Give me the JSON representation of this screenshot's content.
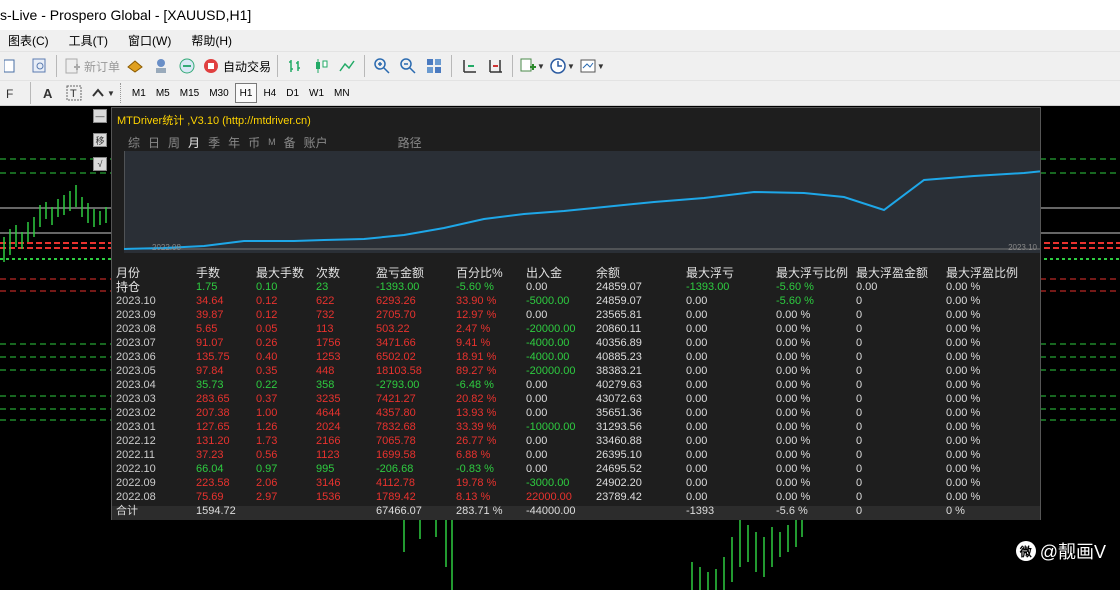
{
  "window": {
    "title": "s-Live - Prospero Global - [XAUUSD,H1]"
  },
  "menu": [
    "图表(C)",
    "工具(T)",
    "窗口(W)",
    "帮助(H)"
  ],
  "toolbar": {
    "new_order": "新订单",
    "auto_trade": "自动交易"
  },
  "timeframes": [
    "M1",
    "M5",
    "M15",
    "M30",
    "H1",
    "H4",
    "D1",
    "W1",
    "MN"
  ],
  "active_timeframe": "H1",
  "panel": {
    "title": "MTDriver统计 ,V3.10 (http://mtdriver.cn)",
    "tabs": [
      "综",
      "日",
      "周",
      "月",
      "季",
      "年",
      "币",
      "M",
      "备",
      "账户",
      "路径"
    ],
    "active_tab": "月",
    "curve_start_label": "2022.08",
    "curve_end_label": "2023.10"
  },
  "table": {
    "headers": [
      "月份",
      "手数",
      "最大手数",
      "次数",
      "盈亏金额",
      "百分比%",
      "出入金",
      "余额",
      "最大浮亏",
      "最大浮亏比例",
      "最大浮盈金额",
      "最大浮盈比例"
    ],
    "hold": {
      "label": "持仓",
      "lots": "1.75",
      "maxlot": "0.10",
      "count": "23",
      "pl": "-1393.00",
      "pct": "-5.60 %",
      "io": "0.00",
      "bal": "24859.07",
      "mdd": "-1393.00",
      "mddp": "-5.60 %",
      "mfp": "0.00",
      "mfpp": "0.00 %"
    },
    "rows": [
      {
        "month": "2023.10",
        "lots": "34.64",
        "maxlot": "0.12",
        "count": "622",
        "pl": "6293.26",
        "pct": "33.90 %",
        "io": "-5000.00",
        "bal": "24859.07",
        "mdd": "0.00",
        "mddp": "-5.60 %",
        "mfp": "0",
        "mfpp": "0.00 %",
        "pos": true
      },
      {
        "month": "2023.09",
        "lots": "39.87",
        "maxlot": "0.12",
        "count": "732",
        "pl": "2705.70",
        "pct": "12.97 %",
        "io": "0.00",
        "bal": "23565.81",
        "mdd": "0.00",
        "mddp": "0.00 %",
        "mfp": "0",
        "mfpp": "0.00 %",
        "pos": true
      },
      {
        "month": "2023.08",
        "lots": "5.65",
        "maxlot": "0.05",
        "count": "113",
        "pl": "503.22",
        "pct": "2.47 %",
        "io": "-20000.00",
        "bal": "20860.11",
        "mdd": "0.00",
        "mddp": "0.00 %",
        "mfp": "0",
        "mfpp": "0.00 %",
        "pos": true
      },
      {
        "month": "2023.07",
        "lots": "91.07",
        "maxlot": "0.26",
        "count": "1756",
        "pl": "3471.66",
        "pct": "9.41 %",
        "io": "-4000.00",
        "bal": "40356.89",
        "mdd": "0.00",
        "mddp": "0.00 %",
        "mfp": "0",
        "mfpp": "0.00 %",
        "pos": true
      },
      {
        "month": "2023.06",
        "lots": "135.75",
        "maxlot": "0.40",
        "count": "1253",
        "pl": "6502.02",
        "pct": "18.91 %",
        "io": "-4000.00",
        "bal": "40885.23",
        "mdd": "0.00",
        "mddp": "0.00 %",
        "mfp": "0",
        "mfpp": "0.00 %",
        "pos": true
      },
      {
        "month": "2023.05",
        "lots": "97.84",
        "maxlot": "0.35",
        "count": "448",
        "pl": "18103.58",
        "pct": "89.27 %",
        "io": "-20000.00",
        "bal": "38383.21",
        "mdd": "0.00",
        "mddp": "0.00 %",
        "mfp": "0",
        "mfpp": "0.00 %",
        "pos": true
      },
      {
        "month": "2023.04",
        "lots": "35.73",
        "maxlot": "0.22",
        "count": "358",
        "pl": "-2793.00",
        "pct": "-6.48 %",
        "io": "0.00",
        "bal": "40279.63",
        "mdd": "0.00",
        "mddp": "0.00 %",
        "mfp": "0",
        "mfpp": "0.00 %",
        "pos": false
      },
      {
        "month": "2023.03",
        "lots": "283.65",
        "maxlot": "0.37",
        "count": "3235",
        "pl": "7421.27",
        "pct": "20.82 %",
        "io": "0.00",
        "bal": "43072.63",
        "mdd": "0.00",
        "mddp": "0.00 %",
        "mfp": "0",
        "mfpp": "0.00 %",
        "pos": true
      },
      {
        "month": "2023.02",
        "lots": "207.38",
        "maxlot": "1.00",
        "count": "4644",
        "pl": "4357.80",
        "pct": "13.93 %",
        "io": "0.00",
        "bal": "35651.36",
        "mdd": "0.00",
        "mddp": "0.00 %",
        "mfp": "0",
        "mfpp": "0.00 %",
        "pos": true
      },
      {
        "month": "2023.01",
        "lots": "127.65",
        "maxlot": "1.26",
        "count": "2024",
        "pl": "7832.68",
        "pct": "33.39 %",
        "io": "-10000.00",
        "bal": "31293.56",
        "mdd": "0.00",
        "mddp": "0.00 %",
        "mfp": "0",
        "mfpp": "0.00 %",
        "pos": true
      },
      {
        "month": "2022.12",
        "lots": "131.20",
        "maxlot": "1.73",
        "count": "2166",
        "pl": "7065.78",
        "pct": "26.77 %",
        "io": "0.00",
        "bal": "33460.88",
        "mdd": "0.00",
        "mddp": "0.00 %",
        "mfp": "0",
        "mfpp": "0.00 %",
        "pos": true
      },
      {
        "month": "2022.11",
        "lots": "37.23",
        "maxlot": "0.56",
        "count": "1123",
        "pl": "1699.58",
        "pct": "6.88 %",
        "io": "0.00",
        "bal": "26395.10",
        "mdd": "0.00",
        "mddp": "0.00 %",
        "mfp": "0",
        "mfpp": "0.00 %",
        "pos": true
      },
      {
        "month": "2022.10",
        "lots": "66.04",
        "maxlot": "0.97",
        "count": "995",
        "pl": "-206.68",
        "pct": "-0.83 %",
        "io": "0.00",
        "bal": "24695.52",
        "mdd": "0.00",
        "mddp": "0.00 %",
        "mfp": "0",
        "mfpp": "0.00 %",
        "pos": false
      },
      {
        "month": "2022.09",
        "lots": "223.58",
        "maxlot": "2.06",
        "count": "3146",
        "pl": "4112.78",
        "pct": "19.78 %",
        "io": "-3000.00",
        "bal": "24902.20",
        "mdd": "0.00",
        "mddp": "0.00 %",
        "mfp": "0",
        "mfpp": "0.00 %",
        "pos": true
      },
      {
        "month": "2022.08",
        "lots": "75.69",
        "maxlot": "2.97",
        "count": "1536",
        "pl": "1789.42",
        "pct": "8.13 %",
        "io": "22000.00",
        "bal": "23789.42",
        "mdd": "0.00",
        "mddp": "0.00 %",
        "mfp": "0",
        "mfpp": "0.00 %",
        "pos": true
      }
    ],
    "total": {
      "label": "合计",
      "lots": "1594.72",
      "pl": "67466.07",
      "pct": "283.71 %",
      "io": "-44000.00",
      "mdd": "-1393",
      "mddp": "-5.6 %",
      "mfp": "0",
      "mfpp": "0 %"
    }
  },
  "watermark": "@靓画V",
  "colors": {
    "profit": "#e8322e",
    "loss": "#2ecc40",
    "curve": "#1ea7e8",
    "title": "#ffd400"
  }
}
